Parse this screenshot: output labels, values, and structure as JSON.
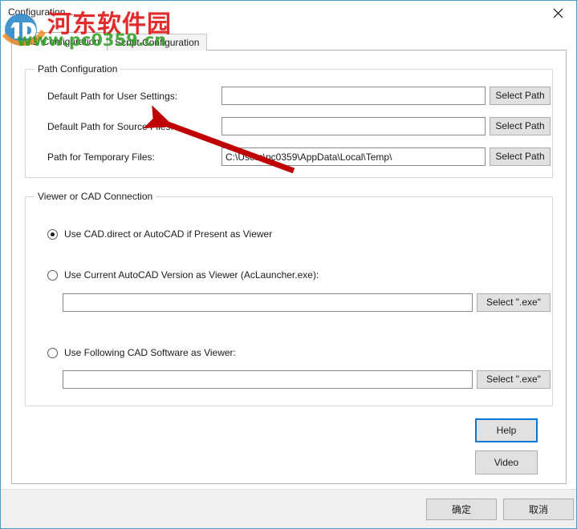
{
  "window": {
    "title": "Configuration ...",
    "close_icon": "close-icon"
  },
  "tabs": [
    {
      "label": "CAD Configuration",
      "active": true
    },
    {
      "label": "Script Configuration",
      "active": false
    }
  ],
  "path_group": {
    "title": "Path Configuration",
    "rows": [
      {
        "label": "Default Path for User Settings:",
        "value": "",
        "button": "Select Path"
      },
      {
        "label": "Default Path for Source Files:",
        "value": "",
        "button": "Select Path"
      },
      {
        "label": "Path for Temporary Files:",
        "value": "C:\\Users\\pc0359\\AppData\\Local\\Temp\\",
        "button": "Select Path"
      }
    ]
  },
  "viewer_group": {
    "title": "Viewer or CAD Connection",
    "options": [
      {
        "label": "Use CAD.direct or AutoCAD if Present as Viewer",
        "checked": true,
        "has_input": false
      },
      {
        "label": "Use Current AutoCAD Version as Viewer (AcLauncher.exe):",
        "checked": false,
        "has_input": true,
        "value": "",
        "button": "Select \".exe\""
      },
      {
        "label": "Use Following CAD Software as Viewer:",
        "checked": false,
        "has_input": true,
        "value": "",
        "button": "Select \".exe\""
      }
    ]
  },
  "side_buttons": {
    "help": "Help",
    "video": "Video"
  },
  "footer": {
    "ok": "确定",
    "cancel": "取消"
  },
  "watermark": {
    "site_name": "河东软件园",
    "url": "www.pc0359.cn"
  },
  "colors": {
    "accent": "#0078d7",
    "window_border": "#4a9ec7",
    "annotation_arrow": "#c00000",
    "watermark_red": "#e01b1b",
    "watermark_green": "#2f9e23"
  }
}
